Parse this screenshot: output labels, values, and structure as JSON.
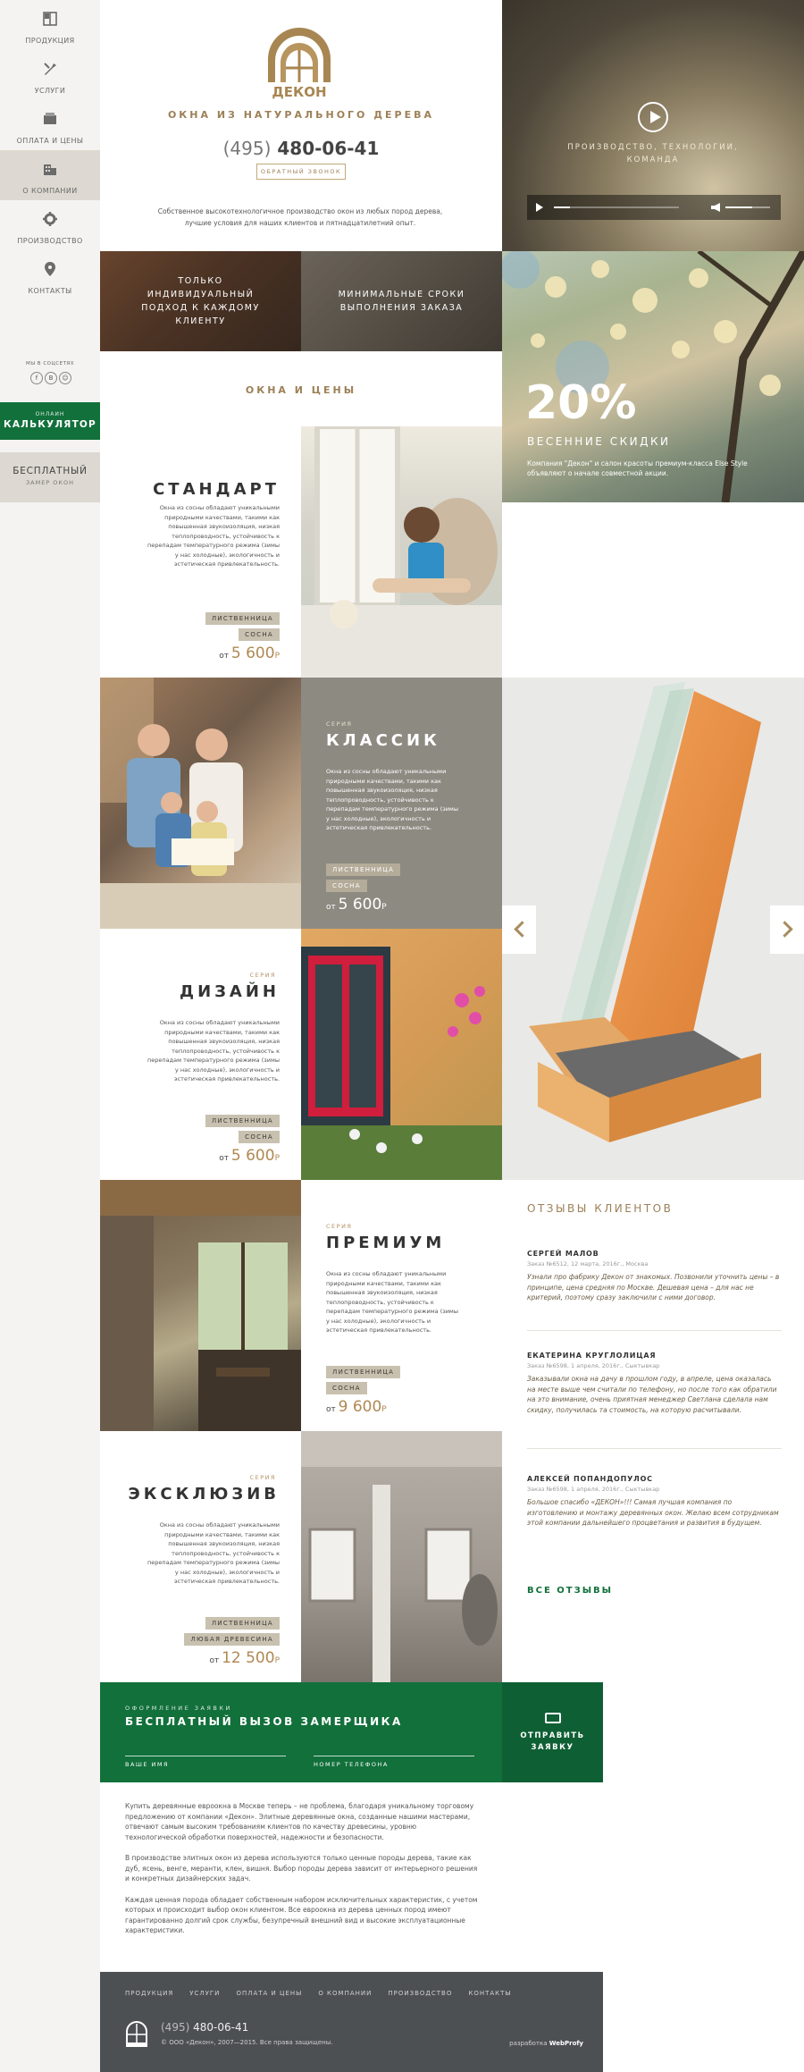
{
  "colors": {
    "accent": "#9d8057",
    "green": "#12703b",
    "sidebar_bg": "#f4f3f1",
    "footer_bg": "#4d5053"
  },
  "sidebar": {
    "items": [
      {
        "label": "ПРОДУКЦИЯ",
        "icon": "window-icon"
      },
      {
        "label": "УСЛУГИ",
        "icon": "tools-icon"
      },
      {
        "label": "ОПЛАТА И ЦЕНЫ",
        "icon": "wallet-icon"
      },
      {
        "label": "О КОМПАНИИ",
        "icon": "building-icon"
      },
      {
        "label": "ПРОИЗВОДСТВО",
        "icon": "gear-icon"
      },
      {
        "label": "КОНТАКТЫ",
        "icon": "map-pin-icon"
      }
    ],
    "social_title": "МЫ В СОЦСЕТЯХ",
    "social": [
      "f",
      "В",
      "☺"
    ],
    "calc": {
      "small": "ОНЛАЙН",
      "big": "КАЛЬКУЛЯТОР"
    },
    "measure": {
      "big": "БЕСПЛАТНЫЙ",
      "small": "ЗАМЕР ОКОН"
    }
  },
  "header": {
    "logo_text": "ДЕКОН",
    "tagline": "ОКНА ИЗ НАТУРАЛЬНОГО ДЕРЕВА",
    "phone_code": "(495)",
    "phone_number": "480-06-41",
    "callback": "ОБРАТНЫЙ ЗВОНОК",
    "intro": "Собственное высокотехнологичное производство окон из любых пород дерева, лучшие условия для наших клиентов и пятнадцатилетний опыт."
  },
  "video": {
    "caption_line1": "ПРОИЗВОДСТВО, ТЕХНОЛОГИИ,",
    "caption_line2": "КОМАНДА"
  },
  "features": [
    {
      "line1": "ТОЛЬКО",
      "line2": "ИНДИВИДУАЛЬНЫЙ",
      "line3": "ПОДХОД К КАЖДОМУ",
      "line4": "КЛИЕНТУ"
    },
    {
      "line1": "МИНИМАЛЬНЫЕ СРОКИ",
      "line2": "ВЫПОЛНЕНИЯ ЗАКАЗА"
    }
  ],
  "promo": {
    "percent": "20%",
    "title": "ВЕСЕННИЕ СКИДКИ",
    "text": "Компания \"Декон\" и салон красоты премиум-класса Else Style объявляют о начале совместной акции."
  },
  "section_title": "ОКНА И ЦЕНЫ",
  "products": [
    {
      "serie": "",
      "name": "СТАНДАРТ",
      "desc": "Окна из сосны обладают уникальными природными качествами, такими как повышенная звукоизоляция, низкая теплопроводность, устойчивость к перепадам температурного режима (зимы у нас холодные), экологичность и эстетическая привлекательность.",
      "tag1": "ЛИСТВЕННИЦА",
      "tag2": "СОСНА",
      "from": "от",
      "price": "5 600",
      "cur": "Р"
    },
    {
      "serie": "СЕРИЯ",
      "name": "КЛАССИК",
      "desc": "Окна из сосны обладают уникальными природными качествами, такими как повышенная звукоизоляция, низкая теплопроводность, устойчивость к перепадам температурного режима (зимы у нас холодные), экологичность и эстетическая привлекательность.",
      "tag1": "ЛИСТВЕННИЦА",
      "tag2": "СОСНА",
      "from": "от",
      "price": "5 600",
      "cur": "Р"
    },
    {
      "serie": "СЕРИЯ",
      "name": "ДИЗАЙН",
      "desc": "Окна из сосны обладают уникальными природными качествами, такими как повышенная звукоизоляция, низкая теплопроводность, устойчивость к перепадам температурного режима (зимы у нас холодные), экологичность и эстетическая привлекательность.",
      "tag1": "ЛИСТВЕННИЦА",
      "tag2": "СОСНА",
      "from": "от",
      "price": "5 600",
      "cur": "Р"
    },
    {
      "serie": "СЕРИЯ",
      "name": "ПРЕМИУМ",
      "desc": "Окна из сосны обладают уникальными природными качествами, такими как повышенная звукоизоляция, низкая теплопроводность, устойчивость к перепадам температурного режима (зимы у нас холодные), экологичность и эстетическая привлекательность.",
      "tag1": "ЛИСТВЕННИЦА",
      "tag2": "СОСНА",
      "from": "от",
      "price": "9 600",
      "cur": "Р"
    },
    {
      "serie": "СЕРИЯ",
      "name": "ЭКСКЛЮЗИВ",
      "desc": "Окна из сосны обладают уникальными природными качествами, такими как повышенная звукоизоляция, низкая теплопроводность, устойчивость к перепадам температурного режима (зимы у нас холодные), экологичность и эстетическая привлекательность.",
      "tag1": "ЛИСТВЕННИЦА",
      "tag2": "ЛЮБАЯ ДРЕВЕСИНА",
      "from": "от",
      "price": "12 500",
      "cur": "Р"
    }
  ],
  "reviews": {
    "title": "ОТЗЫВЫ КЛИЕНТОВ",
    "items": [
      {
        "name": "СЕРГЕЙ МАЛОВ",
        "meta": "Заказ №6512, 12 марта, 2016г., Москва",
        "text": "Узнали про фабрику Декон от знакомых. Позвонили уточнить цены – в принципе, цена средняя по Москве. Дешевая цена – для нас не критерий, поэтому сразу заключили с ними договор."
      },
      {
        "name": "ЕКАТЕРИНА КРУГЛОЛИЦАЯ",
        "meta": "Заказ №6598, 1 апреля, 2016г., Сыктывкар",
        "text": "Заказывали окна на дачу в прошлом году, в апреле, цена оказалась на месте выше чем считали по телефону, но после того как обратили на это внимание, очень приятная менеджер Светлана сделала нам скидку, получилась та стоимость, на которую расчитывали."
      },
      {
        "name": "АЛЕКСЕЙ ПОПАНДОПУЛОС",
        "meta": "Заказ №6598, 1 апреля, 2016г., Сыктывкар",
        "text": "Большое спасибо «ДЕКОН»!!! Самая лучшая компания по изготовлению и монтажу деревянных окон. Желаю всем сотрудникам этой компании дальнейшего процветания и развития в будущем."
      }
    ],
    "all": "ВСЕ ОТЗЫВЫ"
  },
  "order": {
    "small": "ОФОРМЛЕНИЕ ЗАЯВКИ",
    "title": "БЕСПЛАТНЫЙ ВЫЗОВ ЗАМЕРЩИКА",
    "name_label": "ВАШЕ ИМЯ",
    "phone_label": "НОМЕР ТЕЛЕФОНА",
    "send_line1": "ОТПРАВИТЬ",
    "send_line2": "ЗАЯВКУ"
  },
  "seo": [
    "Купить деревянные евроокна в Москве теперь – не проблема, благодаря уникальному торговому предложению от компании «Декон». Элитные деревянные окна, созданные нашими мастерами, отвечают самым высоким требованиям клиентов по качеству древесины, уровню технологической обработки поверхностей, надежности и безопасности.",
    "В производстве элитных окон из дерева используются только ценные породы дерева, такие как дуб, ясень, венге, меранти, клен, вишня. Выбор породы дерева зависит от интерьерного решения и конкретных дизайнерских задач.",
    "Каждая ценная порода обладает собственным набором исключительных характеристик, с учетом которых и происходит выбор окон клиентом. Все евроокна из дерева ценных пород имеют гарантированно долгий срок службы, безупречный внешний вид и высокие эксплуатационные характеристики."
  ],
  "footer": {
    "nav": [
      "ПРОДУКЦИЯ",
      "УСЛУГИ",
      "ОПЛАТА И ЦЕНЫ",
      "О КОМПАНИИ",
      "ПРОИЗВОДСТВО",
      "КОНТАКТЫ"
    ],
    "phone_code": "(495)",
    "phone_number": "480-06-41",
    "copyright": "© ООО «Декон», 2007—2015.  Все права защищены.",
    "dev_label": "разработка",
    "dev_name": "WebProfy"
  }
}
